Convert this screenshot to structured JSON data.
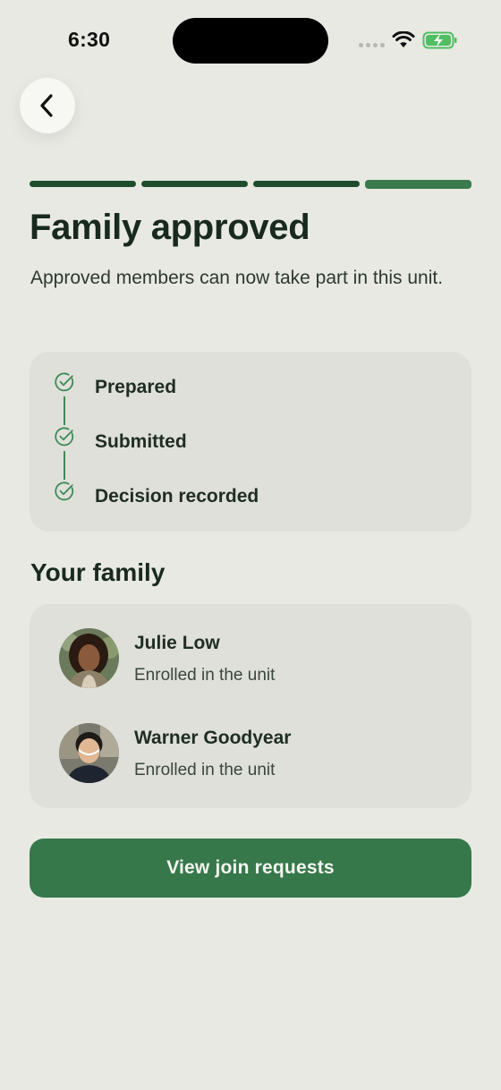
{
  "status_bar": {
    "time": "6:30"
  },
  "header": {
    "back_icon": "chevron-left-icon"
  },
  "progress": {
    "total_steps": 4,
    "current_step": 4
  },
  "page": {
    "title": "Family approved",
    "subtitle": "Approved members can now take part in this unit."
  },
  "steps": [
    {
      "label": "Prepared",
      "icon": "check-circle-icon"
    },
    {
      "label": "Submitted",
      "icon": "check-circle-icon"
    },
    {
      "label": "Decision recorded",
      "icon": "check-circle-icon"
    }
  ],
  "family": {
    "title": "Your family",
    "members": [
      {
        "name": "Julie Low",
        "status": "Enrolled in the unit"
      },
      {
        "name": "Warner Goodyear",
        "status": "Enrolled in the unit"
      }
    ]
  },
  "cta": {
    "label": "View join requests"
  },
  "colors": {
    "background": "#e8e9e3",
    "accent": "#37784b",
    "progress_dark": "#1e4d2c",
    "check": "#3f8a57"
  }
}
